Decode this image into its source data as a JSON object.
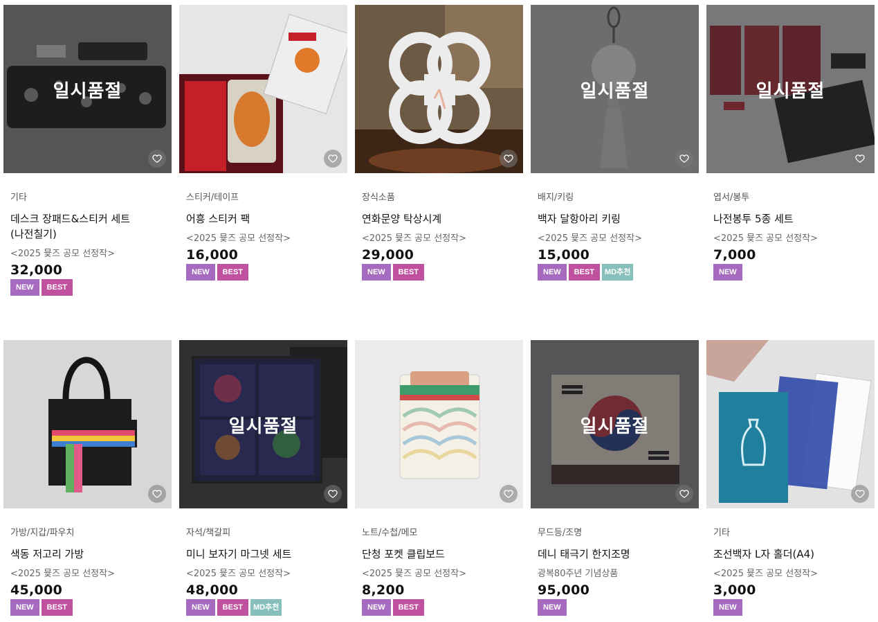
{
  "common": {
    "soldout_label": "일시품절"
  },
  "badge_colors": {
    "NEW": "#a66bbf",
    "BEST": "#c0519f",
    "MD추천": "#86bfbc"
  },
  "products": [
    {
      "category": "기타",
      "name_line1": "데스크 장패드&스티커 세트",
      "name_line2": "(나전칠기)",
      "sub": "<2025 뮻즈 공모 선정작>",
      "price": "32,000",
      "soldout": true,
      "badges": [
        "NEW",
        "BEST"
      ],
      "image": "desk-pad"
    },
    {
      "category": "스티커/테이프",
      "name_line1": "어흥 스티커 팩",
      "name_line2": "",
      "sub": "<2025 뮻즈 공모 선정작>",
      "price": "16,000",
      "soldout": false,
      "badges": [
        "NEW",
        "BEST"
      ],
      "image": "tiger-sticker"
    },
    {
      "category": "장식소품",
      "name_line1": "연화문양 탁상시계",
      "name_line2": "",
      "sub": "<2025 뮻즈 공모 선정작>",
      "price": "29,000",
      "soldout": false,
      "badges": [
        "NEW",
        "BEST"
      ],
      "image": "lotus-clock"
    },
    {
      "category": "배지/키링",
      "name_line1": "백자 달항아리 키링",
      "name_line2": "",
      "sub": "<2025 뮻즈 공모 선정작>",
      "price": "15,000",
      "soldout": true,
      "badges": [
        "NEW",
        "BEST",
        "MD추천"
      ],
      "image": "moon-jar-keyring"
    },
    {
      "category": "엽서/봉투",
      "name_line1": "나전봉투 5종 세트",
      "name_line2": "",
      "sub": "<2025 뮻즈 공모 선정작>",
      "price": "7,000",
      "soldout": true,
      "badges": [
        "NEW"
      ],
      "image": "envelopes"
    },
    {
      "category": "가방/지갑/파우치",
      "name_line1": "색동 저고리 가방",
      "name_line2": "",
      "sub": "<2025 뮻즈 공모 선정작>",
      "price": "45,000",
      "soldout": false,
      "badges": [
        "NEW",
        "BEST"
      ],
      "image": "saekdong-bag"
    },
    {
      "category": "자석/책갈피",
      "name_line1": "미니 보자기 마그넷 세트",
      "name_line2": "",
      "sub": "<2025 뮻즈 공모 선정작>",
      "price": "48,000",
      "soldout": true,
      "badges": [
        "NEW",
        "BEST",
        "MD추천"
      ],
      "image": "bojagi-magnet"
    },
    {
      "category": "노트/수첩/메모",
      "name_line1": "단청 포켓 클립보드",
      "name_line2": "",
      "sub": "<2025 뮻즈 공모 선정작>",
      "price": "8,200",
      "soldout": false,
      "badges": [
        "NEW",
        "BEST"
      ],
      "image": "dancheong-clipboard"
    },
    {
      "category": "무드등/조명",
      "name_line1": "데니 태극기 한지조명",
      "name_line2": "",
      "sub": "광복80주년 기념상품",
      "price": "95,000",
      "soldout": true,
      "badges": [
        "NEW"
      ],
      "image": "taegukgi-lamp"
    },
    {
      "category": "기타",
      "name_line1": "조선백자 L자 홀더(A4)",
      "name_line2": "",
      "sub": "<2025 뮻즈 공모 선정작>",
      "price": "3,000",
      "soldout": false,
      "badges": [
        "NEW"
      ],
      "image": "lfolder"
    }
  ]
}
